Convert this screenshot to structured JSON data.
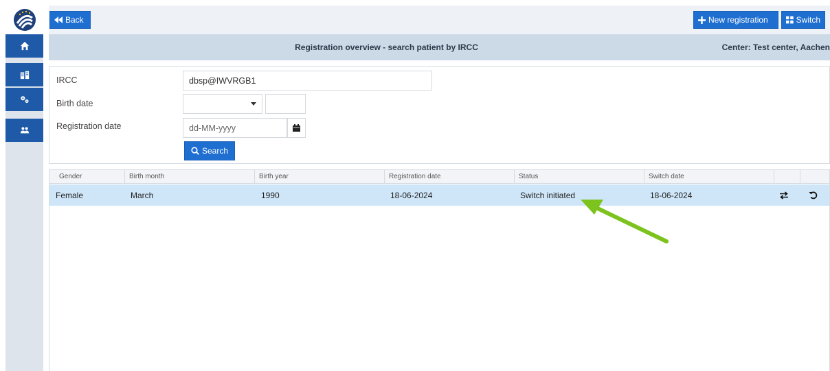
{
  "topbar": {
    "back_label": "Back",
    "new_registration_label": "New registration",
    "switch_label": "Switch"
  },
  "titlebar": {
    "title": "Registration overview - search patient by IRCC",
    "center": "Center: Test center, Aachen"
  },
  "search": {
    "ircc_label": "IRCC",
    "ircc_value": "dbsp@IWVRGB1",
    "birth_date_label": "Birth date",
    "registration_date_label": "Registration date",
    "registration_date_placeholder": "dd-MM-yyyy",
    "search_label": "Search"
  },
  "table": {
    "columns": [
      "Gender",
      "Birth month",
      "Birth year",
      "Registration date",
      "Status",
      "Switch date"
    ],
    "rows": [
      {
        "gender": "Female",
        "birth_month": "March",
        "birth_year": "1990",
        "registration_date": "18-06-2024",
        "status": "Switch initiated",
        "switch_date": "18-06-2024"
      }
    ]
  },
  "colors": {
    "accent": "#1f6fd1",
    "sidebar_active": "#1e5aa8",
    "row_selected": "#cfe6f8",
    "annotation_arrow": "#7dc31e"
  },
  "icons": [
    "logo-icon",
    "home-icon",
    "building-icon",
    "cogs-icon",
    "users-icon",
    "back-icon",
    "plus-icon",
    "grid-icon",
    "caret-down-icon",
    "calendar-icon",
    "search-icon",
    "switch-icon",
    "undo-icon"
  ]
}
